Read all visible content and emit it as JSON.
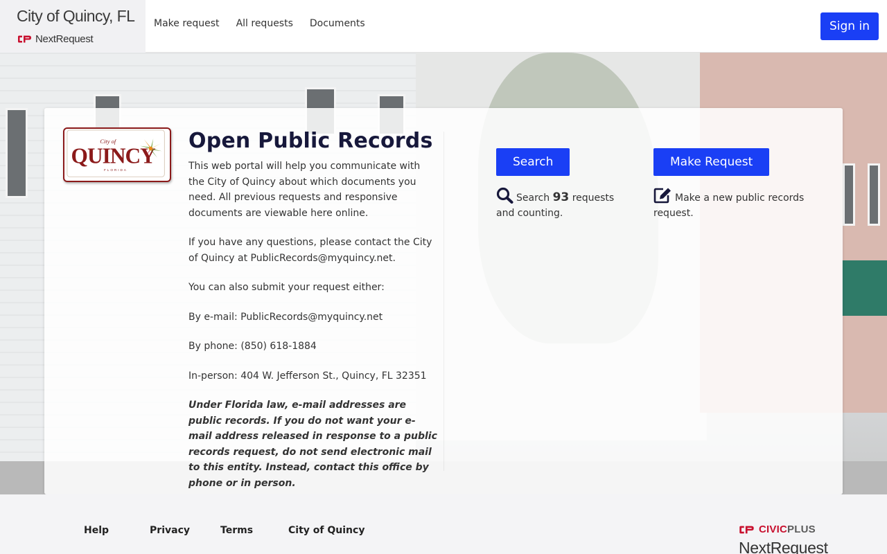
{
  "header": {
    "site_title": "City of Quincy, FL",
    "brand_name": "NextRequest",
    "nav": [
      {
        "label": "Make request"
      },
      {
        "label": "All requests"
      },
      {
        "label": "Documents"
      }
    ],
    "signin_label": "Sign in"
  },
  "main": {
    "logo": {
      "small_text": "City of",
      "name": "QUINCY",
      "state": "FLORIDA"
    },
    "title": "Open Public Records",
    "paragraphs": [
      "This web portal will help you communicate with the City of Quincy about which documents you need. All previous requests and responsive documents are viewable here online.",
      "If you have any questions, please contact the City of Quincy at PublicRecords@myquincy.net.",
      "You can also submit your request either:",
      "By e-mail: PublicRecords@myquincy.net",
      "By phone: (850) 618-1884",
      "In-person: 404 W. Jefferson St., Quincy, FL 32351"
    ],
    "notice": "Under Florida law, e-mail addresses are public records. If you do not want your e-mail address released in response to a public records request, do not send electronic mail to this entity. Instead, contact this office by phone or in person.",
    "search": {
      "button_label": "Search",
      "desc_prefix": "Search",
      "count": "93",
      "desc_suffix": "requests and counting.",
      "icon": "search-icon"
    },
    "request": {
      "button_label": "Make Request",
      "desc": "Make a new public records request.",
      "icon": "edit-icon"
    }
  },
  "footer": {
    "links": [
      {
        "label": "Help"
      },
      {
        "label": "Privacy"
      },
      {
        "label": "Terms"
      },
      {
        "label": "City of Quincy"
      }
    ],
    "civic_brand": "CIVIC",
    "civic_brand_2": "PLUS",
    "product": "NextRequest"
  },
  "colors": {
    "primary": "#1a3ff5",
    "title": "#17183b",
    "brand_red": "#c8102e"
  }
}
